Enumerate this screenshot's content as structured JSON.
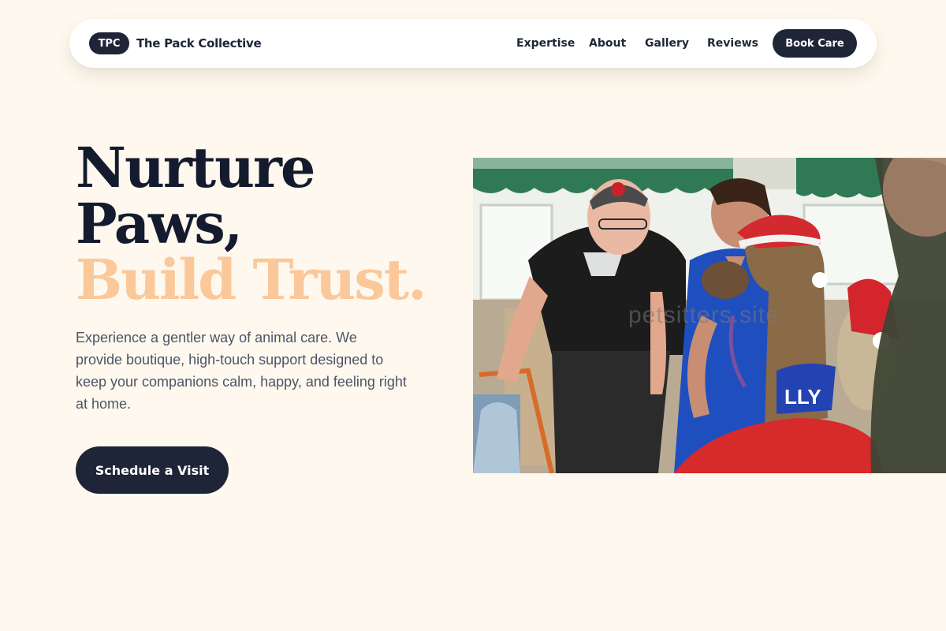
{
  "nav": {
    "brand_badge": "TPC",
    "brand_name": "The Pack Collective",
    "links": [
      "Expertise",
      "About",
      "Gallery",
      "Reviews"
    ],
    "cta_label": "Book Care"
  },
  "hero": {
    "title_line1": "Nurture",
    "title_line2": "Paws,",
    "title_line3": "Build Trust.",
    "description": "Experience a gentler way of animal care. We provide boutique, high-touch support designed to keep your companions calm, happy, and feeling right at home.",
    "cta_label": "Schedule a Visit"
  },
  "photo": {
    "watermark": "petsitters.site",
    "alpaca_coat_text": "LLY"
  },
  "colors": {
    "background": "#fef8ee",
    "navy": "#1e2537",
    "accent_peach": "#fbc89a",
    "body_text": "#4c5568"
  }
}
